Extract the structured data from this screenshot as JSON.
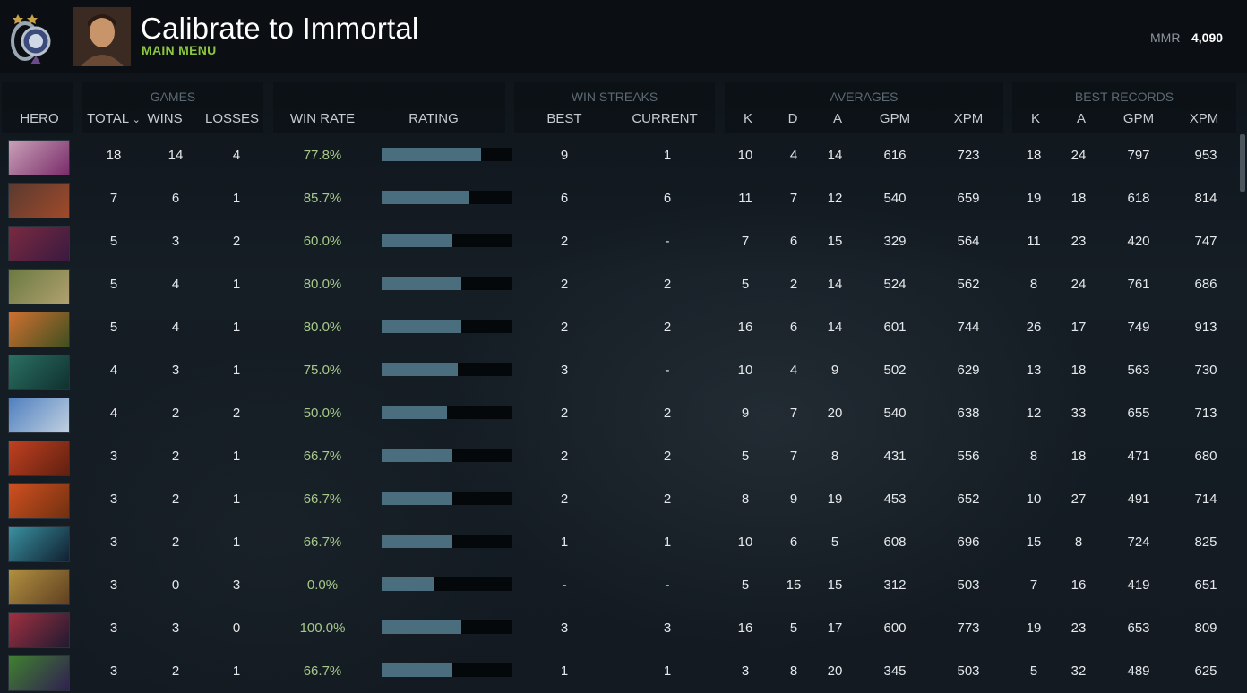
{
  "header": {
    "title": "Calibrate to Immortal",
    "subtitle": "MAIN MENU",
    "mmr_label": "MMR",
    "mmr_value": "4,090"
  },
  "groups": {
    "games": "GAMES",
    "win_streaks": "WIN STREAKS",
    "averages": "AVERAGES",
    "best_records": "BEST RECORDS"
  },
  "columns": {
    "hero": "HERO",
    "total": "TOTAL",
    "wins": "WINS",
    "losses": "LOSSES",
    "win_rate": "WIN RATE",
    "rating": "RATING",
    "best": "BEST",
    "current": "CURRENT",
    "avg_k": "K",
    "avg_d": "D",
    "avg_a": "A",
    "avg_gpm": "GPM",
    "avg_xpm": "XPM",
    "best_k": "K",
    "best_a": "A",
    "best_gpm": "GPM",
    "best_xpm": "XPM"
  },
  "colors": {
    "accent_green": "#8cc63f",
    "win_rate": "#a6c98a",
    "rating_bar": "#4a6e7e"
  },
  "rows": [
    {
      "hero_icon": "invoker-portrait",
      "colors": [
        "#c9a0b8",
        "#7a2d6a"
      ],
      "total": "18",
      "wins": "14",
      "losses": "4",
      "win_rate": "77.8%",
      "rating": 0.76,
      "best": "9",
      "current": "1",
      "avg_k": "10",
      "avg_d": "4",
      "avg_a": "14",
      "avg_gpm": "616",
      "avg_xpm": "723",
      "best_k": "18",
      "best_a": "24",
      "best_gpm": "797",
      "best_xpm": "953"
    },
    {
      "hero_icon": "monkey-hero-portrait",
      "colors": [
        "#5a3a30",
        "#a04a2a"
      ],
      "total": "7",
      "wins": "6",
      "losses": "1",
      "win_rate": "85.7%",
      "rating": 0.67,
      "best": "6",
      "current": "6",
      "avg_k": "11",
      "avg_d": "7",
      "avg_a": "12",
      "avg_gpm": "540",
      "avg_xpm": "659",
      "best_k": "19",
      "best_a": "18",
      "best_gpm": "618",
      "best_xpm": "814"
    },
    {
      "hero_icon": "demon-hero-portrait",
      "colors": [
        "#7a2a40",
        "#3a1a40"
      ],
      "total": "5",
      "wins": "3",
      "losses": "2",
      "win_rate": "60.0%",
      "rating": 0.54,
      "best": "2",
      "current": "-",
      "avg_k": "7",
      "avg_d": "6",
      "avg_a": "15",
      "avg_gpm": "329",
      "avg_xpm": "564",
      "best_k": "11",
      "best_a": "23",
      "best_gpm": "420",
      "best_xpm": "747"
    },
    {
      "hero_icon": "undead-hero-portrait",
      "colors": [
        "#6a7a40",
        "#b0a070"
      ],
      "total": "5",
      "wins": "4",
      "losses": "1",
      "win_rate": "80.0%",
      "rating": 0.61,
      "best": "2",
      "current": "2",
      "avg_k": "5",
      "avg_d": "2",
      "avg_a": "14",
      "avg_gpm": "524",
      "avg_xpm": "562",
      "best_k": "8",
      "best_a": "24",
      "best_gpm": "761",
      "best_xpm": "686"
    },
    {
      "hero_icon": "fire-hero-portrait",
      "colors": [
        "#d07030",
        "#405020"
      ],
      "total": "5",
      "wins": "4",
      "losses": "1",
      "win_rate": "80.0%",
      "rating": 0.61,
      "best": "2",
      "current": "2",
      "avg_k": "16",
      "avg_d": "6",
      "avg_a": "14",
      "avg_gpm": "601",
      "avg_xpm": "744",
      "best_k": "26",
      "best_a": "17",
      "best_gpm": "749",
      "best_xpm": "913"
    },
    {
      "hero_icon": "spirit-hero-portrait",
      "colors": [
        "#2a7060",
        "#103030"
      ],
      "total": "4",
      "wins": "3",
      "losses": "1",
      "win_rate": "75.0%",
      "rating": 0.58,
      "best": "3",
      "current": "-",
      "avg_k": "10",
      "avg_d": "4",
      "avg_a": "9",
      "avg_gpm": "502",
      "avg_xpm": "629",
      "best_k": "13",
      "best_a": "18",
      "best_gpm": "563",
      "best_xpm": "730"
    },
    {
      "hero_icon": "frost-hero-portrait",
      "colors": [
        "#5080c0",
        "#c0d0e0"
      ],
      "total": "4",
      "wins": "2",
      "losses": "2",
      "win_rate": "50.0%",
      "rating": 0.5,
      "best": "2",
      "current": "2",
      "avg_k": "9",
      "avg_d": "7",
      "avg_a": "20",
      "avg_gpm": "540",
      "avg_xpm": "638",
      "best_k": "12",
      "best_a": "33",
      "best_gpm": "655",
      "best_xpm": "713"
    },
    {
      "hero_icon": "ember-hero-portrait",
      "colors": [
        "#c04020",
        "#602010"
      ],
      "total": "3",
      "wins": "2",
      "losses": "1",
      "win_rate": "66.7%",
      "rating": 0.54,
      "best": "2",
      "current": "2",
      "avg_k": "5",
      "avg_d": "7",
      "avg_a": "8",
      "avg_gpm": "431",
      "avg_xpm": "556",
      "best_k": "8",
      "best_a": "18",
      "best_gpm": "471",
      "best_xpm": "680"
    },
    {
      "hero_icon": "blaze-hero-portrait",
      "colors": [
        "#d05020",
        "#703010"
      ],
      "total": "3",
      "wins": "2",
      "losses": "1",
      "win_rate": "66.7%",
      "rating": 0.54,
      "best": "2",
      "current": "2",
      "avg_k": "8",
      "avg_d": "9",
      "avg_a": "19",
      "avg_gpm": "453",
      "avg_xpm": "652",
      "best_k": "10",
      "best_a": "27",
      "best_gpm": "491",
      "best_xpm": "714"
    },
    {
      "hero_icon": "phantom-hero-portrait",
      "colors": [
        "#3a90a0",
        "#102030"
      ],
      "total": "3",
      "wins": "2",
      "losses": "1",
      "win_rate": "66.7%",
      "rating": 0.54,
      "best": "1",
      "current": "1",
      "avg_k": "10",
      "avg_d": "6",
      "avg_a": "5",
      "avg_gpm": "608",
      "avg_xpm": "696",
      "best_k": "15",
      "best_a": "8",
      "best_gpm": "724",
      "best_xpm": "825"
    },
    {
      "hero_icon": "ogre-hero-portrait",
      "colors": [
        "#b09040",
        "#604020"
      ],
      "total": "3",
      "wins": "0",
      "losses": "3",
      "win_rate": "0.0%",
      "rating": 0.4,
      "best": "-",
      "current": "-",
      "avg_k": "5",
      "avg_d": "15",
      "avg_a": "15",
      "avg_gpm": "312",
      "avg_xpm": "503",
      "best_k": "7",
      "best_a": "16",
      "best_gpm": "419",
      "best_xpm": "651"
    },
    {
      "hero_icon": "queen-hero-portrait",
      "colors": [
        "#a03040",
        "#201a30"
      ],
      "total": "3",
      "wins": "3",
      "losses": "0",
      "win_rate": "100.0%",
      "rating": 0.61,
      "best": "3",
      "current": "3",
      "avg_k": "16",
      "avg_d": "5",
      "avg_a": "17",
      "avg_gpm": "600",
      "avg_xpm": "773",
      "best_k": "19",
      "best_a": "23",
      "best_gpm": "653",
      "best_xpm": "809"
    },
    {
      "hero_icon": "venom-hero-portrait",
      "colors": [
        "#408030",
        "#302050"
      ],
      "total": "3",
      "wins": "2",
      "losses": "1",
      "win_rate": "66.7%",
      "rating": 0.54,
      "best": "1",
      "current": "1",
      "avg_k": "3",
      "avg_d": "8",
      "avg_a": "20",
      "avg_gpm": "345",
      "avg_xpm": "503",
      "best_k": "5",
      "best_a": "32",
      "best_gpm": "489",
      "best_xpm": "625"
    }
  ]
}
